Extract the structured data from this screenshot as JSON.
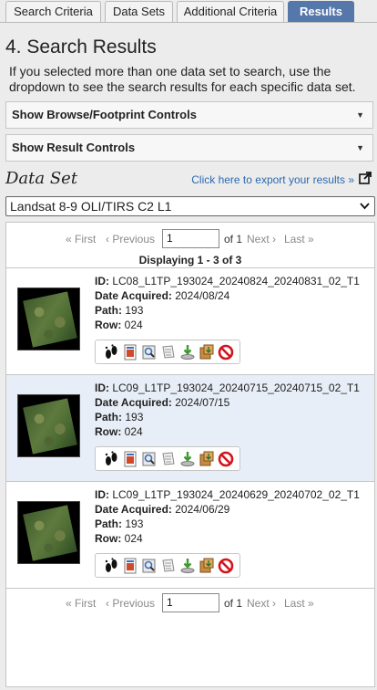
{
  "tabs": [
    {
      "label": "Search Criteria"
    },
    {
      "label": "Data Sets"
    },
    {
      "label": "Additional Criteria"
    },
    {
      "label": "Results",
      "active": true
    }
  ],
  "page": {
    "title": "4. Search Results",
    "description": "If you selected more than one data set to search, use the dropdown to see the search results for each specific data set."
  },
  "panels": {
    "browse_footprint": "Show Browse/Footprint Controls",
    "result_controls": "Show Result Controls"
  },
  "dataset": {
    "label": "Data Set",
    "export_link": "Click here to export your results »",
    "selected": "Landsat 8-9 OLI/TIRS C2 L1"
  },
  "pager": {
    "first": "« First",
    "previous": "‹ Previous",
    "page_value": "1",
    "of": "of 1",
    "next": "Next ›",
    "last": "Last »",
    "displaying": "Displaying 1 - 3 of 3"
  },
  "labels": {
    "id": "ID:",
    "date": "Date Acquired:",
    "path": "Path:",
    "row": "Row:"
  },
  "results": [
    {
      "id": "LC08_L1TP_193024_20240824_20240831_02_T1",
      "date": "2024/08/24",
      "path": "193",
      "row": "024"
    },
    {
      "id": "LC09_L1TP_193024_20240715_20240715_02_T1",
      "date": "2024/07/15",
      "path": "193",
      "row": "024"
    },
    {
      "id": "LC09_L1TP_193024_20240629_20240702_02_T1",
      "date": "2024/06/29",
      "path": "193",
      "row": "024"
    }
  ],
  "result_icons": [
    "footprint-icon",
    "browse-overlay-icon",
    "show-metadata-icon",
    "compare-browse-icon",
    "download-options-icon",
    "add-to-bulk-download-icon",
    "exclude-scene-icon"
  ],
  "colors": {
    "active_tab": "#5577aa",
    "link": "#2a6ab0",
    "alt_row": "#e8eef7"
  }
}
